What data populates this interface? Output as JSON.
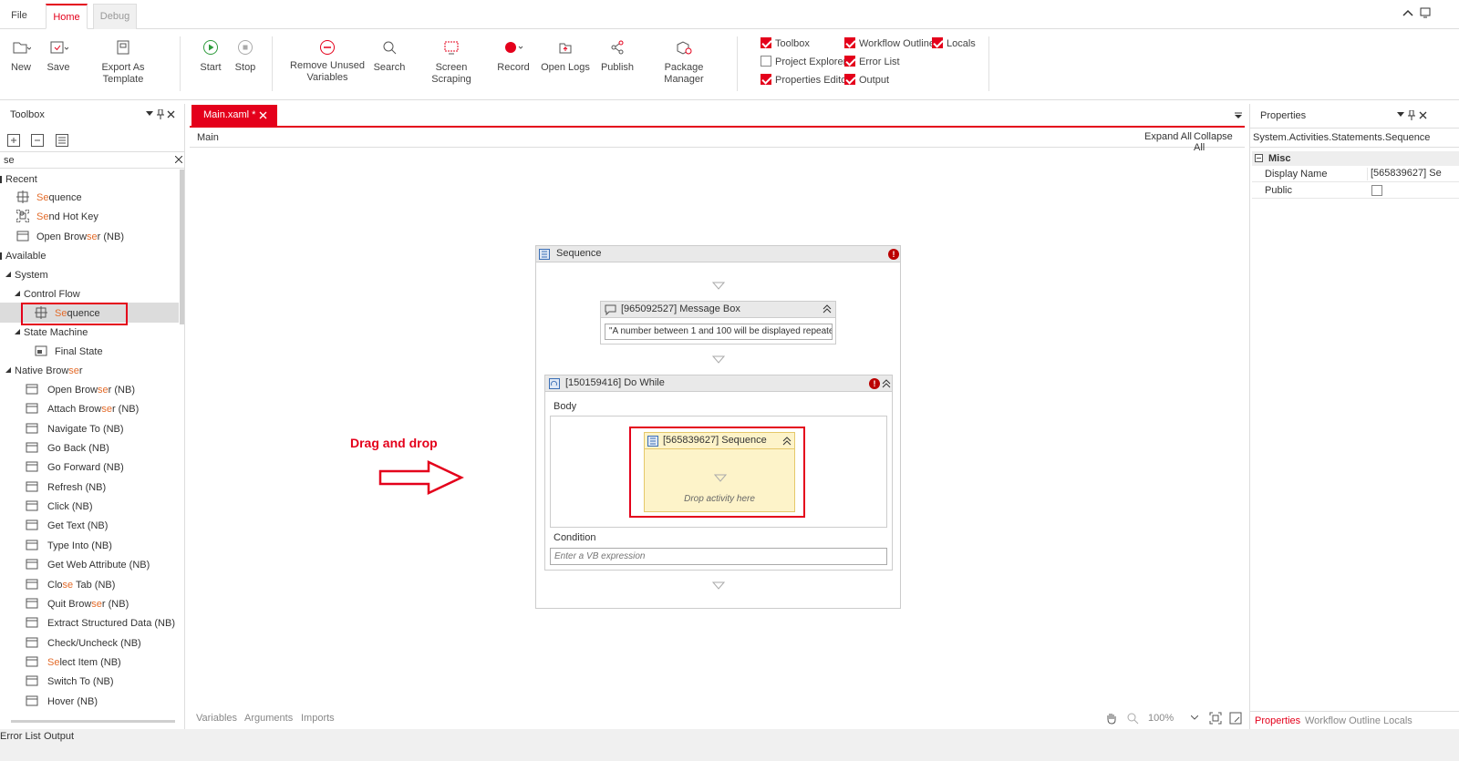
{
  "menu": {
    "file": "File",
    "home": "Home",
    "debug": "Debug"
  },
  "ribbon": {
    "new": "New",
    "save": "Save",
    "export_template": "Export As Template",
    "start": "Start",
    "stop": "Stop",
    "remove_unused_1": "Remove Unused",
    "remove_unused_2": "Variables",
    "search": "Search",
    "screen_scraping": "Screen Scraping",
    "record": "Record",
    "open_logs": "Open Logs",
    "publish": "Publish",
    "package_manager": "Package Manager"
  },
  "panels": {
    "toolbox": {
      "label": "Toolbox",
      "checked": true
    },
    "workflow_outline": {
      "label": "Workflow Outline",
      "checked": true
    },
    "locals": {
      "label": "Locals",
      "checked": true
    },
    "project_explorer": {
      "label": "Project Explorer",
      "checked": false
    },
    "error_list": {
      "label": "Error List",
      "checked": true
    },
    "properties_editor": {
      "label": "Properties Editor",
      "checked": true
    },
    "output": {
      "label": "Output",
      "checked": true
    }
  },
  "toolbox": {
    "title": "Toolbox",
    "search_value": "se",
    "recent_label": "Recent",
    "recent": [
      {
        "pre": "",
        "hl": "Se",
        "post": "quence"
      },
      {
        "pre": "",
        "hl": "Se",
        "post": "nd Hot Key"
      },
      {
        "pre": "Open Brow",
        "hl": "se",
        "post": "r (NB)"
      }
    ],
    "available_label": "Available",
    "system_label": "System",
    "control_flow_label": "Control Flow",
    "cf_sequence": {
      "pre": "",
      "hl": "Se",
      "post": "quence"
    },
    "state_machine_label": "State Machine",
    "final_state": "Final State",
    "native_browser": {
      "pre": "Native Brow",
      "hl": "se",
      "post": "r"
    },
    "nb_items": [
      {
        "pre": "Open Brow",
        "hl": "se",
        "post": "r (NB)"
      },
      {
        "pre": "Attach Brow",
        "hl": "se",
        "post": "r (NB)"
      },
      {
        "pre": "Navigate To (NB)",
        "hl": "",
        "post": ""
      },
      {
        "pre": "Go Back (NB)",
        "hl": "",
        "post": ""
      },
      {
        "pre": "Go Forward (NB)",
        "hl": "",
        "post": ""
      },
      {
        "pre": "Refresh (NB)",
        "hl": "",
        "post": ""
      },
      {
        "pre": "Click (NB)",
        "hl": "",
        "post": ""
      },
      {
        "pre": "Get Text (NB)",
        "hl": "",
        "post": ""
      },
      {
        "pre": "Type Into (NB)",
        "hl": "",
        "post": ""
      },
      {
        "pre": "Get Web Attribute (NB)",
        "hl": "",
        "post": ""
      },
      {
        "pre": "Clo",
        "hl": "se",
        "post": " Tab (NB)"
      },
      {
        "pre": "Quit Brow",
        "hl": "se",
        "post": "r (NB)"
      },
      {
        "pre": "Extract Structured Data (NB)",
        "hl": "",
        "post": ""
      },
      {
        "pre": "Check/Uncheck (NB)",
        "hl": "",
        "post": ""
      },
      {
        "pre": "",
        "hl": "Se",
        "post": "lect Item (NB)"
      },
      {
        "pre": "Switch To (NB)",
        "hl": "",
        "post": ""
      },
      {
        "pre": "Hover (NB)",
        "hl": "",
        "post": ""
      }
    ]
  },
  "designer": {
    "doc_tab": "Main.xaml *",
    "breadcrumb": "Main",
    "expand_all": "Expand All",
    "collapse_all": "Collapse All",
    "seq_title": "Sequence",
    "msgbox_title": "[965092527] Message Box",
    "msgbox_text": "\"A number between 1 and 100 will be displayed repeate",
    "dowhile_title": "[150159416] Do While",
    "body_label": "Body",
    "inner_seq_title": "[565839627] Sequence",
    "drop_hint": "Drop activity here",
    "condition_label": "Condition",
    "condition_placeholder": "Enter a VB expression",
    "annotation": "Drag and drop",
    "bottom_tabs": [
      "Variables",
      "Arguments",
      "Imports"
    ],
    "zoom": "100%"
  },
  "properties": {
    "title": "Properties",
    "type_name": "System.Activities.Statements.Sequence",
    "category": "Misc",
    "display_name_label": "Display Name",
    "display_name_value": "[565839627] Se",
    "public_label": "Public",
    "public_checked": false,
    "bottom_tabs": [
      "Properties",
      "Workflow Outline",
      "Locals"
    ]
  },
  "status": {
    "error_list": "Error List",
    "output": "Output"
  },
  "colors": {
    "accent": "#e4001b",
    "highlight": "#e36c2b",
    "seq_yellow": "#fdf3c9"
  }
}
